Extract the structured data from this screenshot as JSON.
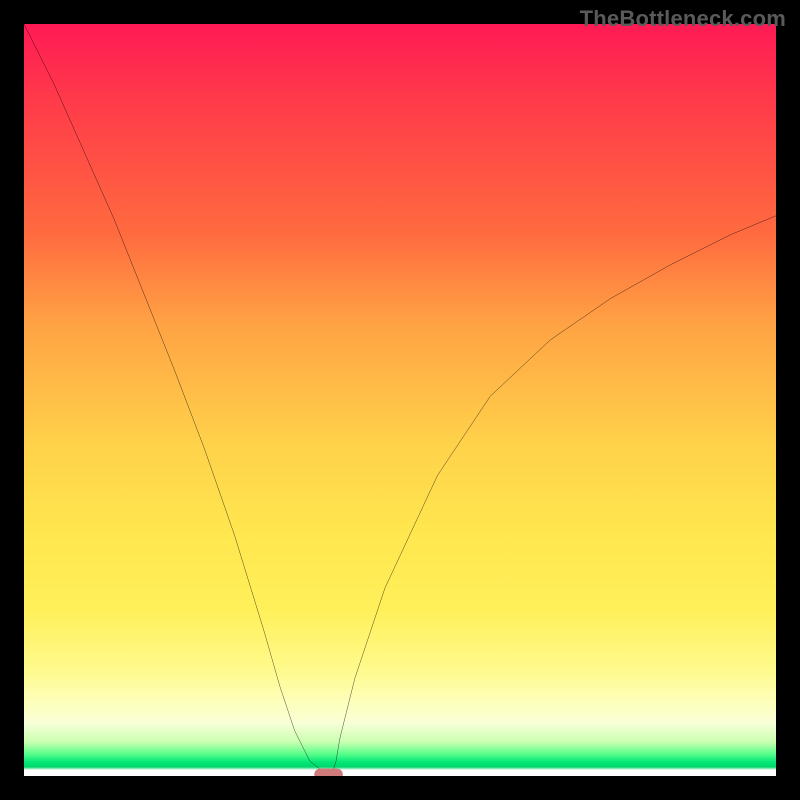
{
  "watermark": "TheBottleneck.com",
  "chart_data": {
    "type": "line",
    "title": "",
    "xlabel": "",
    "ylabel": "",
    "xlim": [
      0,
      100
    ],
    "ylim": [
      0,
      100
    ],
    "grid": false,
    "legend": false,
    "series": [
      {
        "name": "bottleneck-curve",
        "color": "#000000",
        "x": [
          0,
          4,
          8,
          12,
          16,
          20,
          24,
          28,
          32,
          34,
          36,
          38,
          40,
          40.5,
          41,
          41.5,
          42,
          44,
          48,
          55,
          62,
          70,
          78,
          86,
          94,
          100
        ],
        "values": [
          100,
          92,
          83,
          74,
          64,
          54,
          43.5,
          32,
          19,
          12,
          6,
          2,
          0.4,
          0,
          0.4,
          2,
          5,
          13,
          25,
          40,
          50.5,
          58,
          63.5,
          68,
          72,
          74.5
        ]
      }
    ],
    "marker": {
      "name": "optimum-marker",
      "shape": "rounded-rect",
      "color": "#d07b7b",
      "x": 40.5,
      "y": 0,
      "width_pct": 3.8,
      "height_pct": 1.6
    },
    "gradient_stops": [
      {
        "pos": 0,
        "color": "#ff1a55"
      },
      {
        "pos": 0.28,
        "color": "#ff6b3f"
      },
      {
        "pos": 0.56,
        "color": "#ffd24a"
      },
      {
        "pos": 0.78,
        "color": "#fff05a"
      },
      {
        "pos": 0.93,
        "color": "#f8ffd6"
      },
      {
        "pos": 0.97,
        "color": "#5dff8c"
      },
      {
        "pos": 0.99,
        "color": "#ffffff"
      }
    ]
  }
}
